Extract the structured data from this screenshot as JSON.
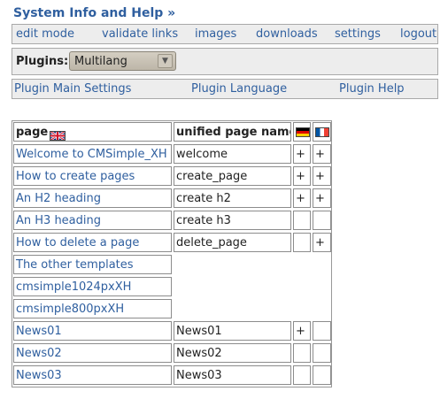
{
  "header": {
    "title": "System Info and Help »"
  },
  "top_nav": [
    {
      "label": "edit mode"
    },
    {
      "label": "validate links"
    },
    {
      "label": "images"
    },
    {
      "label": "downloads"
    },
    {
      "label": "settings"
    },
    {
      "label": "logout"
    }
  ],
  "plugins": {
    "label": "Plugins:",
    "selected": "Multilang"
  },
  "plugin_nav": [
    {
      "label": "Plugin Main Settings"
    },
    {
      "label": "Plugin Language"
    },
    {
      "label": "Plugin Help"
    }
  ],
  "table": {
    "col_page": "page",
    "col_unified": "unified page name",
    "flags": [
      "flag-uk",
      "flag-de",
      "flag-fr"
    ],
    "rows": [
      {
        "page": "Welcome to CMSimple_XH",
        "unified": "welcome",
        "de": "+",
        "fr": "+"
      },
      {
        "page": "How to create pages",
        "unified": "create_page",
        "de": "+",
        "fr": "+"
      },
      {
        "page": "An H2 heading",
        "unified": "create h2",
        "de": "+",
        "fr": "+"
      },
      {
        "page": "An H3 heading",
        "unified": "create h3",
        "de": "",
        "fr": ""
      },
      {
        "page": "How to delete a page",
        "unified": "delete_page",
        "de": "",
        "fr": "+"
      },
      {
        "page": "The other templates"
      },
      {
        "page": "cmsimple1024pxXH"
      },
      {
        "page": "cmsimple800pxXH"
      },
      {
        "page": "News01",
        "unified": "News01",
        "de": "+",
        "fr": ""
      },
      {
        "page": "News02",
        "unified": "News02",
        "de": "",
        "fr": ""
      },
      {
        "page": "News03",
        "unified": "News03",
        "de": "",
        "fr": ""
      }
    ]
  }
}
